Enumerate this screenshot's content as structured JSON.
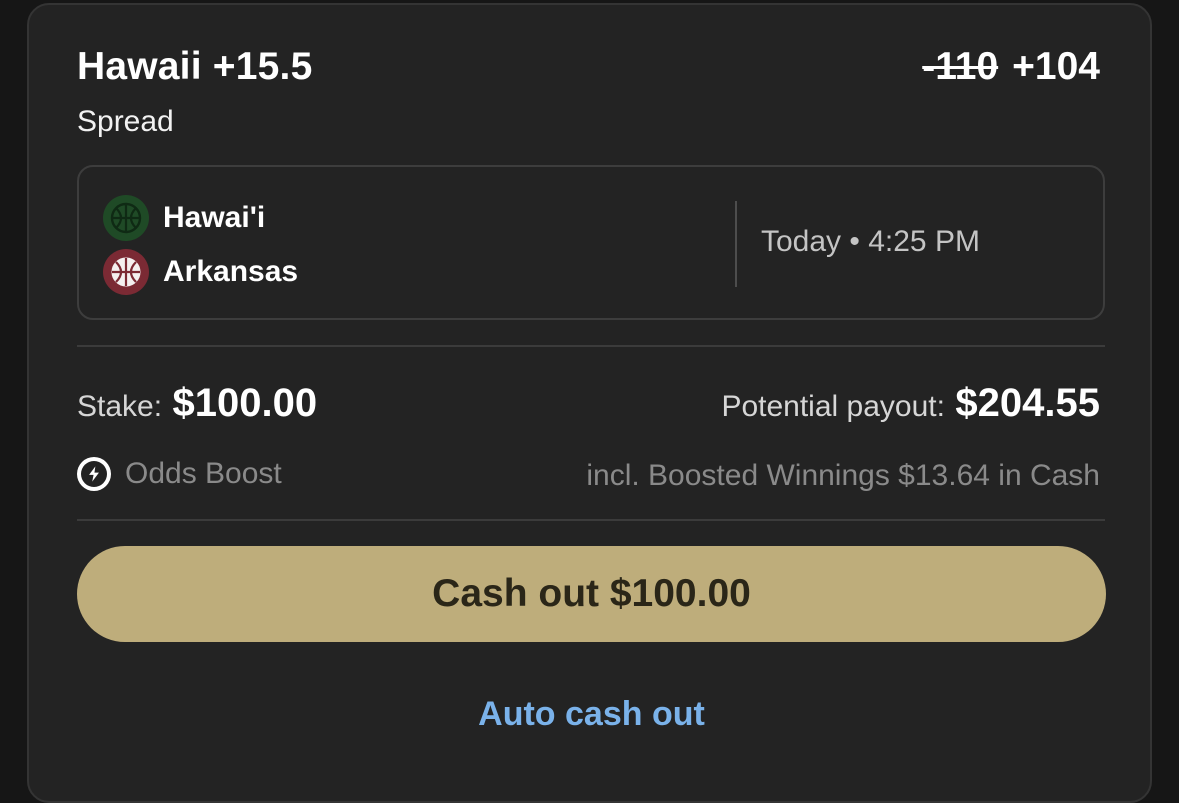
{
  "bet": {
    "title": "Hawaii +15.5",
    "market": "Spread",
    "odds_old": "-110",
    "odds_new": "+104"
  },
  "event": {
    "team1": "Hawai'i",
    "team2": "Arkansas",
    "time": "Today • 4:25 PM",
    "team1_color": "#1f4a26",
    "team2_color": "#7b2a34",
    "team1_icon": "basketball-icon",
    "team2_icon": "basketball-icon"
  },
  "stake": {
    "label": "Stake:",
    "value": "$100.00"
  },
  "payout": {
    "label": "Potential payout:",
    "value": "$204.55"
  },
  "boost": {
    "icon": "lightning-icon",
    "label": "Odds Boost",
    "note": "incl. Boosted Winnings $13.64 in Cash"
  },
  "actions": {
    "cashout_label": "Cash out $100.00",
    "auto_cashout_label": "Auto cash out"
  },
  "colors": {
    "cashout_button": "#bead7b",
    "link": "#7ab2ea",
    "card_background": "#232323"
  }
}
